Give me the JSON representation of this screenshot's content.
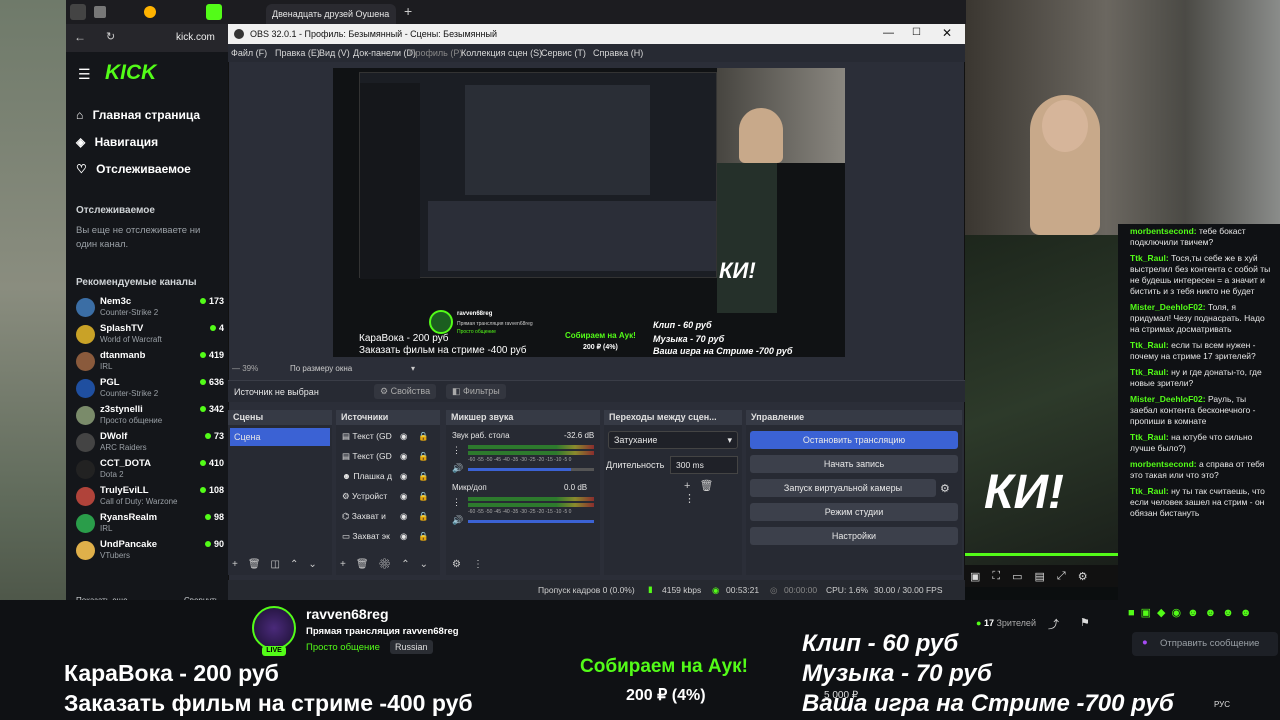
{
  "browser": {
    "tab_title": "Двенадцать друзей Оушена",
    "url": "kick.com"
  },
  "kick": {
    "logo": "KICK",
    "nav": [
      "Главная страница",
      "Навигация",
      "Отслеживаемое"
    ],
    "followed_title": "Отслеживаемое",
    "followed_empty": "Вы еще не отслеживаете ни один канал.",
    "recommended_title": "Рекомендуемые каналы",
    "channels": [
      {
        "name": "Nem3c",
        "category": "Counter-Strike 2",
        "viewers": "173",
        "color": "#3b6ea5"
      },
      {
        "name": "SplashTV",
        "category": "World of Warcraft",
        "viewers": "4",
        "color": "#c9a227"
      },
      {
        "name": "dtanmanb",
        "category": "IRL",
        "viewers": "419",
        "color": "#8a5a3c"
      },
      {
        "name": "PGL",
        "category": "Counter-Strike 2",
        "viewers": "636",
        "color": "#1f4fa0"
      },
      {
        "name": "z3stynelli",
        "category": "Просто общение",
        "viewers": "342",
        "color": "#7a8b6a"
      },
      {
        "name": "DWolf",
        "category": "ARC Raiders",
        "viewers": "73",
        "color": "#444"
      },
      {
        "name": "CCT_DOTA",
        "category": "Dota 2",
        "viewers": "410",
        "color": "#222"
      },
      {
        "name": "TrulyEviLL",
        "category": "Call of Duty: Warzone",
        "viewers": "108",
        "color": "#b0433a"
      },
      {
        "name": "RyansRealm",
        "category": "IRL",
        "viewers": "98",
        "color": "#2a9d4a"
      },
      {
        "name": "UndPancake",
        "category": "VTubers",
        "viewers": "90",
        "color": "#e0b04a"
      }
    ],
    "show_more": "Показать еще",
    "collapse": "Свернуть"
  },
  "obs": {
    "title": "OBS 32.0.1 - Профиль: Безымянный - Сцены: Безымянный",
    "menu": [
      "Файл (F)",
      "Правка (E)",
      "Вид (V)",
      "Док-панели (D)",
      "Профиль (P)",
      "Коллекция сцен (S)",
      "Сервис (T)",
      "Справка (H)"
    ],
    "zoom": "39%",
    "fit": "По размеру окна",
    "source_none": "Источник не выбран",
    "properties": "Свойства",
    "filters": "Фильтры",
    "scenes_title": "Сцены",
    "scene_item": "Сцена",
    "sources_title": "Источники",
    "sources": [
      "Текст (GD",
      "Текст (GD",
      "Плашка д",
      "Устройст",
      "Захват и",
      "Захват эк"
    ],
    "mixer_title": "Микшер звука",
    "mixer": [
      {
        "name": "Звук раб. стола",
        "db": "-32.6 dB",
        "level": 0.82
      },
      {
        "name": "Микр/доп",
        "db": "0.0 dB",
        "level": 1.0
      }
    ],
    "mixer_ticks": "-60 -55 -50 -45 -40 -35 -30 -25 -20 -15 -10 -5 0",
    "transitions_title": "Переходы между сцен...",
    "transition": "Затухание",
    "duration_label": "Длительность",
    "duration": "300 ms",
    "controls_title": "Управление",
    "controls": [
      "Остановить трансляцию",
      "Начать запись",
      "Запуск виртуальной камеры",
      "Режим студии",
      "Настройки"
    ],
    "status": {
      "dropped": "Пропуск кадров 0 (0.0%)",
      "kbps": "4159 kbps",
      "live_time": "00:53:21",
      "rec_time": "00:00:00",
      "cpu": "CPU: 1.6%",
      "fps": "30.00 / 30.00 FPS"
    }
  },
  "overlay": {
    "left1": "КараВока - 200 руб",
    "left2": "Заказать фильм на стриме -400 руб",
    "center_title": "Собираем на Аук!",
    "center_amount": "200 ₽ (4%)",
    "center_goal": "5 000 ₽",
    "right1": "Клип - 60 руб",
    "right2": "Музыка - 70 руб",
    "right3": "Ваша игра на Стриме -700 руб"
  },
  "stream": {
    "channel": "ravven68reg",
    "subtitle": "Прямая трансляция ravven68reg",
    "category": "Просто общение",
    "language": "Russian",
    "live_badge": "LIVE",
    "viewers": "17",
    "viewers_label": "Зрителей"
  },
  "chat": {
    "messages": [
      {
        "user": "morbentsecond:",
        "text": "тебе бокаст подключили твичем?"
      },
      {
        "user": "Ttk_Raul:",
        "text": "Тося,ты себе же в хуй выстрелил без контента с собой ты не будешь интересен = а значит и бистить и з тебя никто не будет"
      },
      {
        "user": "Mister_DeehloF02:",
        "text": "Толя, я придумал! Чезу поднасрать. Надо на стримах досматривать"
      },
      {
        "user": "Ttk_Raul:",
        "text": "если ты всем нужен - почему на стриме 17 зрителей?"
      },
      {
        "user": "Ttk_Raul:",
        "text": "ну и где донаты-то, где новые зрители?"
      },
      {
        "user": "Mister_DeehloF02:",
        "text": "Рауль, ты заебал контента бесконечного - пропиши в комнате"
      },
      {
        "user": "Ttk_Raul:",
        "text": "на ютубе что сильно лучше было?)"
      },
      {
        "user": "morbentsecond:",
        "text": "а справа от тебя это такая или что это?"
      },
      {
        "user": "Ttk_Raul:",
        "text": "ну ты так считаешь, что если человек зашел на стрим - он обязан бистануть"
      }
    ],
    "send_placeholder": "Отправить сообщение"
  },
  "taskbar": {
    "lang": "РУС"
  }
}
